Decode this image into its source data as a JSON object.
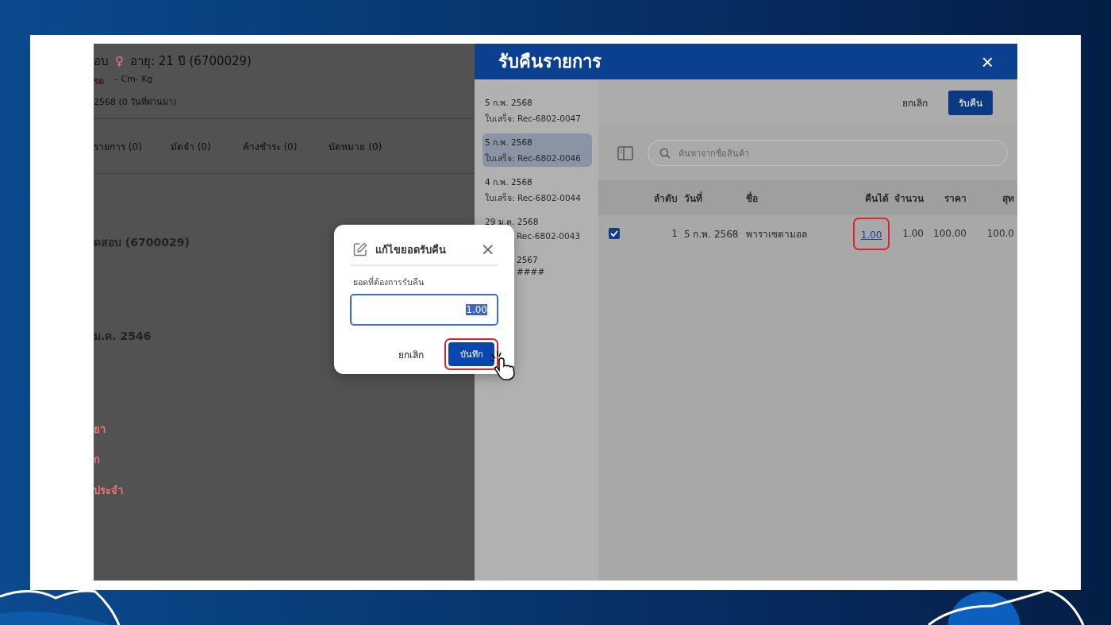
{
  "background_page": {
    "patient_name": "อบ",
    "gender_icon": "♀",
    "age": "อายุ: 21 ปี (6700029)",
    "tag": "รด",
    "body": "- Cm- Kg",
    "visit": "2568 (0 วันที่ผ่านมา)",
    "tabs": [
      "รายการ (0)",
      "มัดจำ (0)",
      "ค้างชำระ (0)",
      "นัดหมาย (0)"
    ],
    "details": [
      {
        "text": "ดสอบ  (6700029)",
        "kind": "bold"
      },
      {
        "text": "ม.ค. 2546",
        "kind": "bold"
      },
      {
        "text": "ยา",
        "kind": "alert"
      },
      {
        "text": "ก",
        "kind": "alert"
      },
      {
        "text": "ประจำ",
        "kind": "alert"
      }
    ]
  },
  "drawer": {
    "title": "รับคืนรายการ",
    "close": "×",
    "receipts": [
      {
        "date": "5 ก.พ. 2568",
        "receipt": "ใบเสร็จ: Rec-6802-0047",
        "selected": false,
        "date_covered": false,
        "receipt_covered": false
      },
      {
        "date": "5 ก.พ. 2568",
        "receipt": "ใบเสร็จ: Rec-6802-0046",
        "selected": true,
        "date_covered": false,
        "receipt_covered": false
      },
      {
        "date": "4 ก.พ. 2568",
        "receipt": "ใบเสร็จ: Rec-6802-0044",
        "selected": false,
        "date_covered": false,
        "receipt_covered": false
      },
      {
        "date": "29 ม.ค. 2568",
        "receipt": "Rec-6802-0043",
        "selected": false,
        "date_covered": false,
        "receipt_covered": true
      },
      {
        "date": "2567",
        "receipt": "####",
        "selected": false,
        "date_covered": true,
        "receipt_covered": true
      }
    ],
    "buttons": [
      {
        "label": "ยกเลิก",
        "kind": "text"
      },
      {
        "label": "รับคืน",
        "kind": "primary"
      }
    ],
    "search": {
      "placeholder": "ค้นหาจากชื่อสินค้า"
    },
    "table": {
      "columns": [
        "ลำดับ",
        "วันที่",
        "ชื่อ",
        "คืนได้",
        "จำนวน",
        "ราคา",
        "สุท"
      ],
      "rows": [
        {
          "checked": true,
          "cells": [
            "1",
            "5 ก.พ. 2568",
            "พาราเซตามอล",
            "1.00",
            "1.00",
            "100.00",
            "100.0"
          ],
          "highlighted": true
        }
      ]
    }
  },
  "dialog": {
    "title": "แก้ไขยอดรับคืน",
    "close": "×",
    "label": "ยอดที่ต้องการรับคืน",
    "value": "1.00",
    "text_selected": true,
    "cancel": "ยกเลิก",
    "save": "บันทึก",
    "save_highlighted": true
  }
}
